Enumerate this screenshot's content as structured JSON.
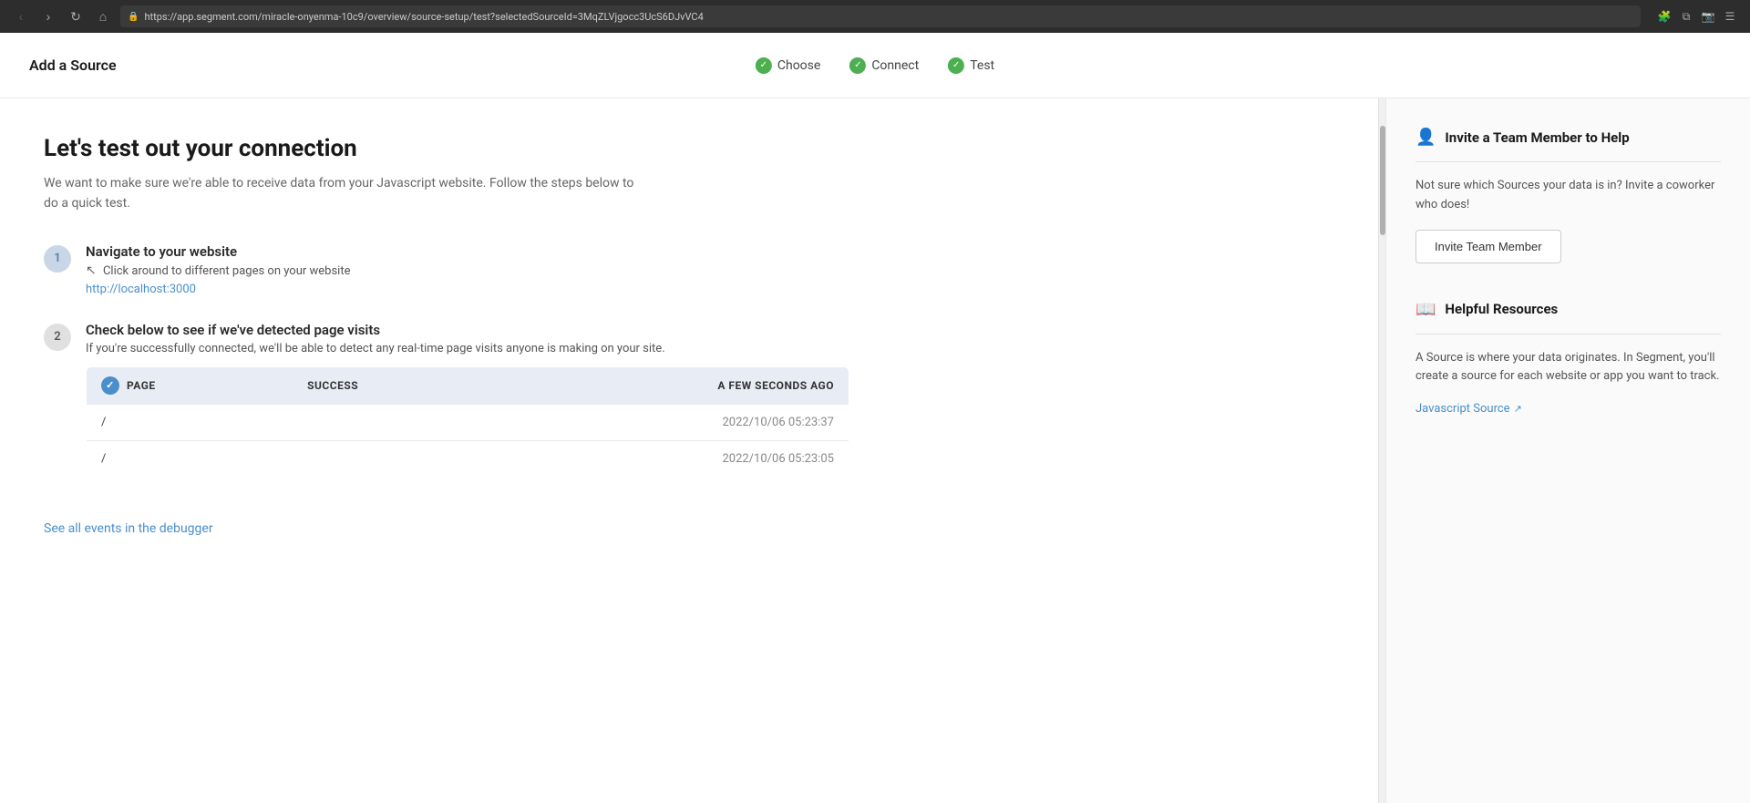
{
  "browser": {
    "url": "https://app.segment.com/miracle-onyenma-10c9/overview/source-setup/test?selectedSourceId=3MqZLVjgocc3UcS6DJvVC4",
    "back_disabled": true,
    "forward_disabled": false
  },
  "header": {
    "title": "Add a Source",
    "steps": [
      {
        "label": "Choose",
        "completed": true
      },
      {
        "label": "Connect",
        "completed": true
      },
      {
        "label": "Test",
        "completed": true
      }
    ]
  },
  "main": {
    "heading": "Let's test out your connection",
    "subtitle": "We want to make sure we're able to receive data from your Javascript website. Follow the steps below to do a quick test.",
    "steps": [
      {
        "number": "1",
        "completed": true,
        "title": "Navigate to your website",
        "desc": "Click around to different pages on your website",
        "link": "http://localhost:3000",
        "has_link": true
      },
      {
        "number": "2",
        "completed": false,
        "title": "Check below to see if we've detected page visits",
        "desc": "If you're successfully connected, we'll be able to detect any real-time page visits anyone is making on your site.",
        "has_link": false
      }
    ],
    "table": {
      "header": {
        "type_col": "PAGE",
        "status_col": "Success",
        "time_col": "A few seconds ago"
      },
      "rows": [
        {
          "path": "/",
          "time": "2022/10/06 05:23:37"
        },
        {
          "path": "/",
          "time": "2022/10/06 05:23:05"
        }
      ]
    },
    "see_all_link": "See all events in the debugger"
  },
  "sidebar": {
    "invite_section": {
      "title": "Invite a Team Member to Help",
      "text": "Not sure which Sources your data is in? Invite a coworker who does!",
      "button_label": "Invite Team Member"
    },
    "helpful_section": {
      "title": "Helpful Resources",
      "text": "A Source is where your data originates. In Segment, you'll create a source for each website or app you want to track.",
      "link_label": "Javascript Source"
    }
  }
}
